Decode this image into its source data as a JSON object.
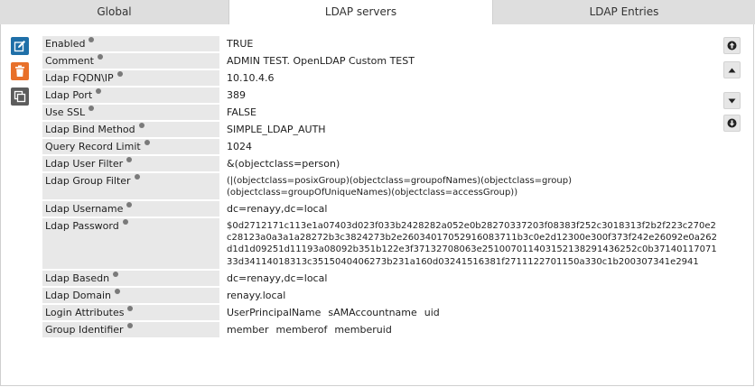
{
  "tabs": [
    {
      "label": "Global"
    },
    {
      "label": "LDAP servers"
    },
    {
      "label": "LDAP Entries"
    }
  ],
  "actions": {
    "edit_icon": "pencil-square-icon",
    "delete_icon": "trash-icon",
    "copy_icon": "copy-icon",
    "nav_icons": [
      "circle-arrow-up-icon",
      "caret-up-icon",
      "caret-down-icon",
      "circle-arrow-down-icon"
    ]
  },
  "fields": {
    "enabled": {
      "label": "Enabled",
      "value": "TRUE"
    },
    "comment": {
      "label": "Comment",
      "value": "ADMIN TEST. OpenLDAP Custom TEST"
    },
    "fqdn": {
      "label": "Ldap FQDN\\IP",
      "value": "10.10.4.6"
    },
    "port": {
      "label": "Ldap Port",
      "value": "389"
    },
    "ssl": {
      "label": "Use SSL",
      "value": "FALSE"
    },
    "bind_method": {
      "label": "Ldap Bind Method",
      "value": "SIMPLE_LDAP_AUTH"
    },
    "query_limit": {
      "label": "Query Record Limit",
      "value": "1024"
    },
    "user_filter": {
      "label": "Ldap User Filter",
      "value": "&(objectclass=person)"
    },
    "group_filter": {
      "label": "Ldap Group Filter",
      "value_line1": "(|(objectclass=posixGroup)(objectclass=groupofNames)(objectclass=group)",
      "value_line2": "(objectclass=groupOfUniqueNames)(objectclass=accessGroup))"
    },
    "username": {
      "label": "Ldap Username",
      "value": "dc=renayy,dc=local"
    },
    "password": {
      "label": "Ldap Password",
      "value": "$0d2712171c113e1a07403d023f033b2428282a052e0b28270337203f08383f252c3018313f2b2f223c270e2c28123a0a3a1a28272b3c3824273b2e26034017052916083711b3c0e2d12300e300f373f242e26092e0a262d1d1d09251d11193a08092b351b122e3f37132708063e251007011403152138291436252c0b3714011707133d34114018313c3515040406273b231a160d03241516381f2711122701150a330c1b200307341e2941"
    },
    "basedn": {
      "label": "Ldap Basedn",
      "value": "dc=renayy,dc=local"
    },
    "domain": {
      "label": "Ldap Domain",
      "value": "renayy.local"
    },
    "login_attrs": {
      "label": "Login Attributes",
      "values": [
        "UserPrincipalName",
        "sAMAccountname",
        "uid"
      ]
    },
    "group_id": {
      "label": "Group Identifier",
      "values": [
        "member",
        "memberof",
        "memberuid"
      ]
    }
  }
}
